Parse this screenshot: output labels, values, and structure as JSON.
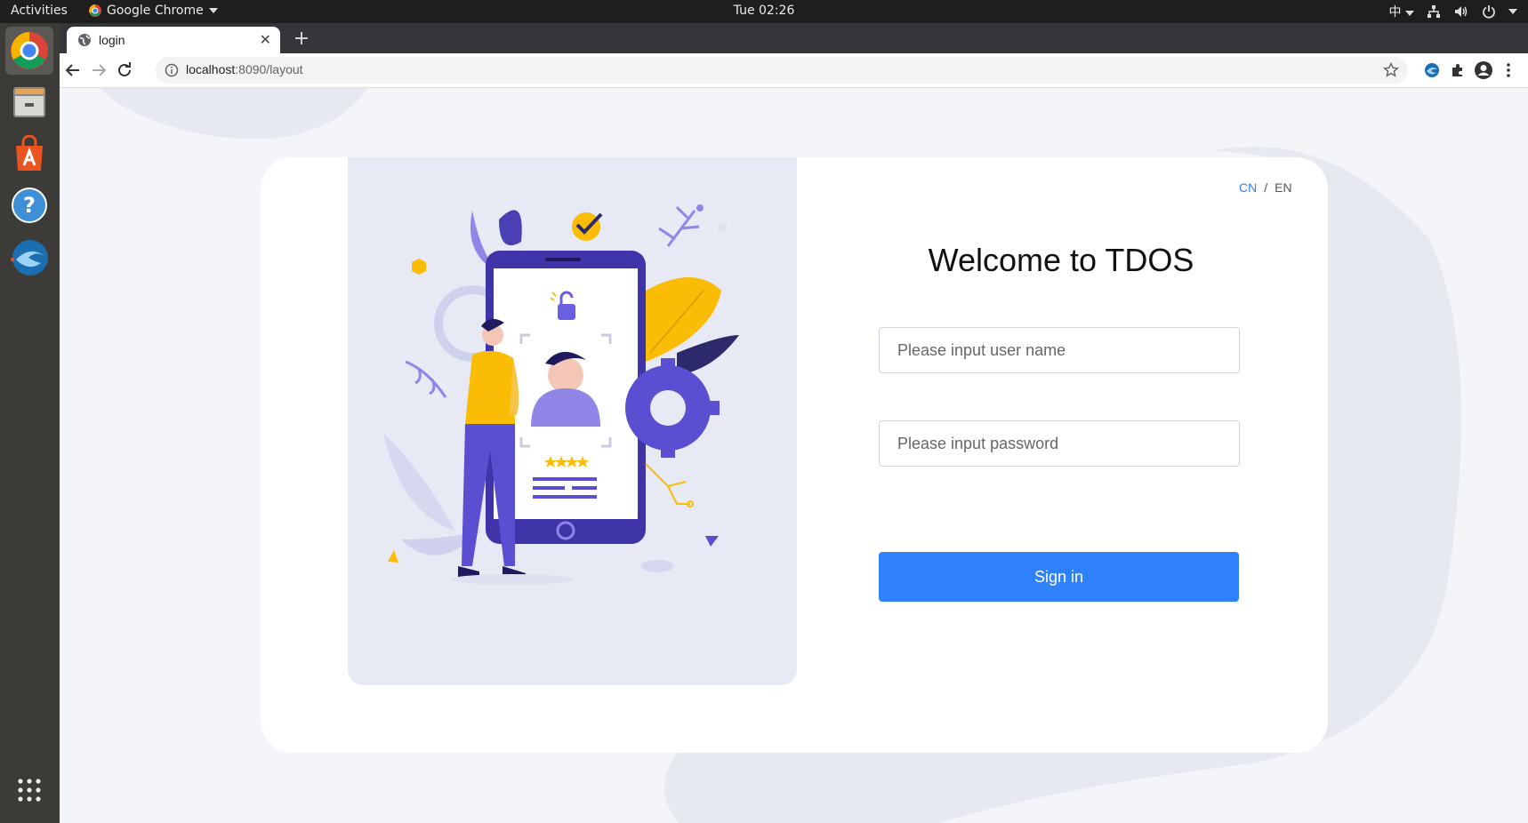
{
  "system": {
    "activities": "Activities",
    "app_name": "Google Chrome",
    "clock": "Tue 02:26",
    "input_method": "中"
  },
  "browser": {
    "tab_title": "login",
    "url_host": "localhost",
    "url_rest": ":8090/layout"
  },
  "page": {
    "lang_cn": "CN",
    "lang_sep": "/",
    "lang_en": "EN",
    "title": "Welcome to TDOS",
    "username_placeholder": "Please input user name",
    "password_placeholder": "Please input password",
    "signin_label": "Sign in",
    "password_mask": "****"
  },
  "colors": {
    "accent": "#2f80fb",
    "illustration_purple": "#5b4fd1",
    "illustration_yellow": "#fbbc05"
  }
}
